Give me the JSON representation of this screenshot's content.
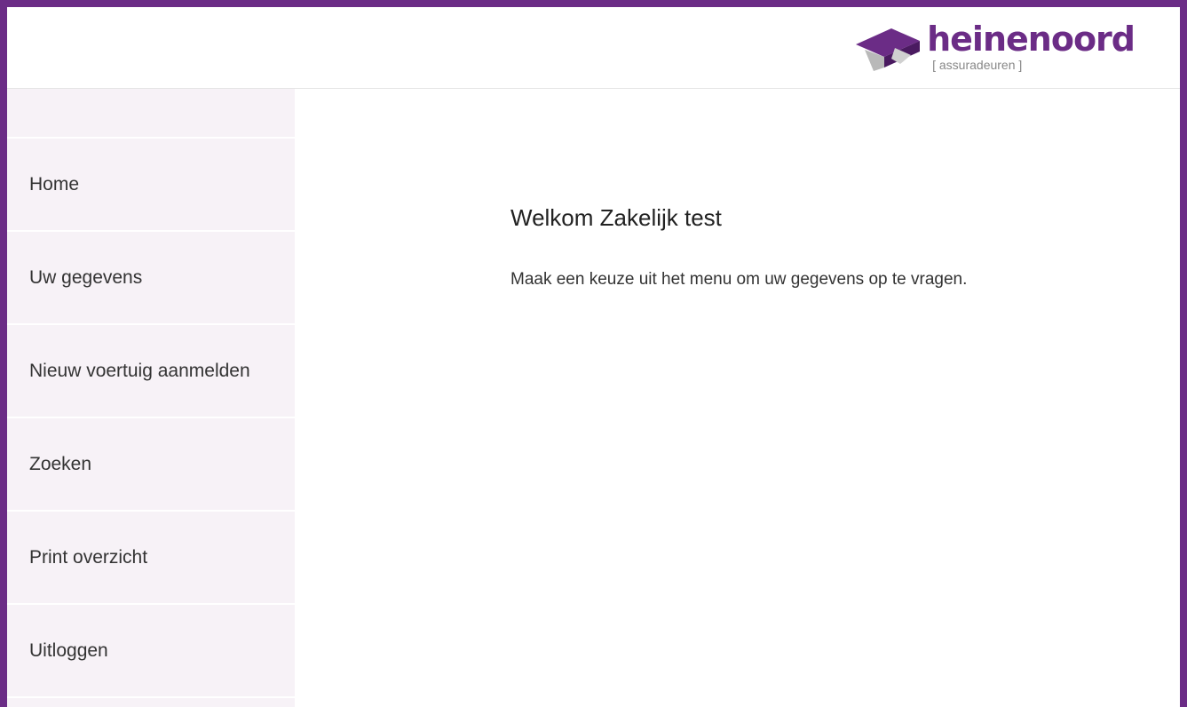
{
  "brand": {
    "name": "heinenoord",
    "tagline": "[ assuradeuren ]",
    "color": "#6b2c86"
  },
  "sidebar": {
    "items": [
      {
        "label": "Home"
      },
      {
        "label": "Uw gegevens"
      },
      {
        "label": "Nieuw voertuig aanmelden"
      },
      {
        "label": "Zoeken"
      },
      {
        "label": "Print overzicht"
      },
      {
        "label": "Uitloggen"
      }
    ]
  },
  "main": {
    "title": "Welkom Zakelijk test",
    "intro": "Maak een keuze uit het menu om uw gegevens op te vragen."
  }
}
